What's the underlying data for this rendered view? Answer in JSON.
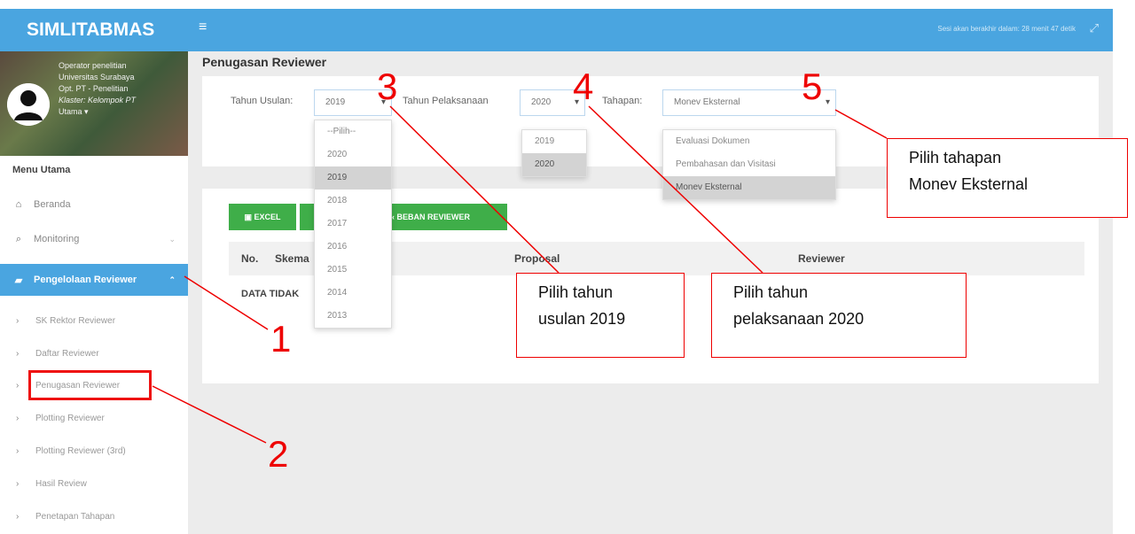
{
  "brand": "SIMLITABMAS",
  "user": {
    "line1": "Operator penelitian",
    "line2": "Universitas Surabaya",
    "line3": "Opt. PT - Penelitian",
    "line4": "Klaster: Kelompok PT",
    "line5": "Utama ▾"
  },
  "menu": {
    "heading": "Menu Utama",
    "beranda": "Beranda",
    "monitoring": "Monitoring",
    "pengelolaan": "Pengelolaan Reviewer",
    "sub": [
      "SK Rektor Reviewer",
      "Daftar Reviewer",
      "Penugasan Reviewer",
      "Plotting Reviewer",
      "Plotting Reviewer (3rd)",
      "Hasil Review",
      "Penetapan Tahapan"
    ]
  },
  "topbar": {
    "session": "Sesi akan berakhir dalam: 28 menit 47 detik"
  },
  "page": {
    "title": "Penugasan Reviewer"
  },
  "filters": {
    "tahun_usulan_label": "Tahun Usulan:",
    "tahun_usulan_value": "2019",
    "tahun_pelaksanaan_label": "Tahun Pelaksanaan",
    "tahun_pelaksanaan_value": "2020",
    "tahapan_label": "Tahapan:",
    "tahapan_value": "Monev Eksternal"
  },
  "dropdowns": {
    "usulan_options": [
      "--Pilih--",
      "2020",
      "2019",
      "2018",
      "2017",
      "2016",
      "2015",
      "2014",
      "2013"
    ],
    "usulan_selected": "2019",
    "pelaksanaan_options": [
      "2019",
      "2020"
    ],
    "pelaksanaan_selected": "2020",
    "tahapan_options": [
      "Evaluasi Dokumen",
      "Pembahasan dan Visitasi",
      "Monev Eksternal"
    ],
    "tahapan_selected": "Monev Eksternal"
  },
  "table": {
    "excel_label": "EXCEL",
    "beban_label": "BEBAN REVIEWER",
    "col_no": "No.",
    "col_skema": "Skema",
    "col_proposal": "Proposal",
    "col_reviewer": "Reviewer",
    "no_data": "DATA TIDAK"
  },
  "annotations": {
    "n1": "1",
    "n2": "2",
    "n3": "3",
    "n4": "4",
    "n5": "5",
    "c3_line1": "Pilih tahun",
    "c3_line2": "usulan 2019",
    "c4_line1": "Pilih tahun",
    "c4_line2": "pelaksanaan 2020",
    "c5_line1": "Pilih tahapan",
    "c5_line2": "Monev Eksternal"
  },
  "colors": {
    "primary": "#4aa5e0",
    "green": "#3fae49",
    "annotation": "#e11111"
  }
}
